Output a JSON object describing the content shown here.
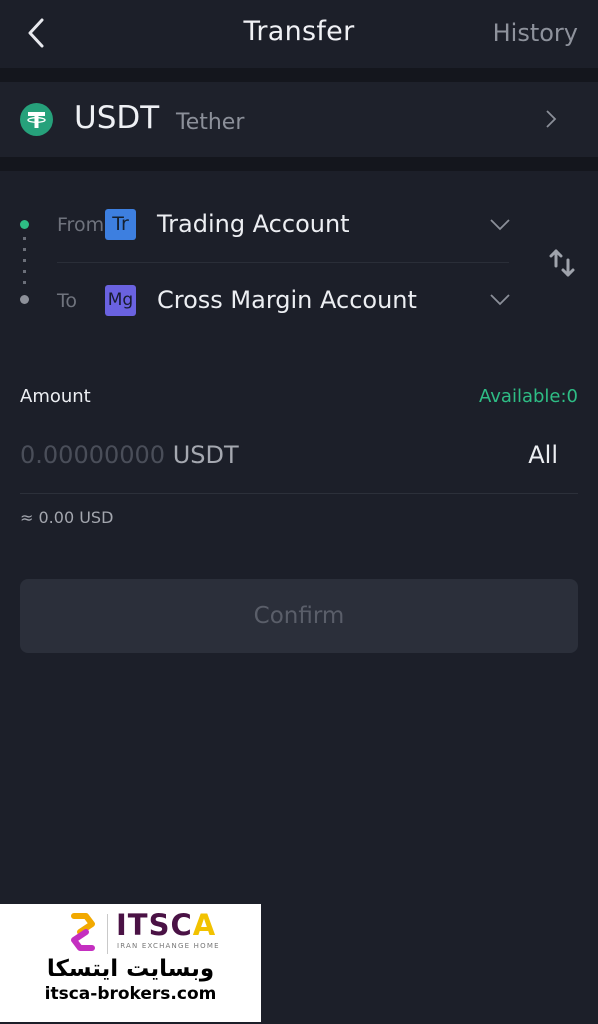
{
  "header": {
    "title": "Transfer",
    "history_label": "History",
    "back_icon": "chevron-left-icon"
  },
  "coin": {
    "symbol": "USDT",
    "name": "Tether",
    "icon": "tether-icon",
    "icon_color": "#26a17b"
  },
  "transfer": {
    "from": {
      "label": "From",
      "badge": "Tr",
      "account": "Trading Account",
      "badge_color": "#3d7fe0"
    },
    "to": {
      "label": "To",
      "badge": "Mg",
      "account": "Cross Margin Account",
      "badge_color": "#6a62e0"
    },
    "swap_icon": "swap-vertical-icon"
  },
  "amount": {
    "label": "Amount",
    "available": "Available:0",
    "placeholder_number": "0.00000000",
    "unit": "USDT",
    "value": "",
    "all_label": "All",
    "approx": "≈ 0.00 USD"
  },
  "confirm_label": "Confirm",
  "colors": {
    "accent_green": "#2ebd85",
    "background": "#1c1f29"
  },
  "watermark": {
    "brand_main": "ITSC",
    "brand_end": "A",
    "tagline": "IRAN EXCHANGE HOME",
    "persian": "وبسایت ایتسکا",
    "url": "itsca-brokers.com"
  }
}
